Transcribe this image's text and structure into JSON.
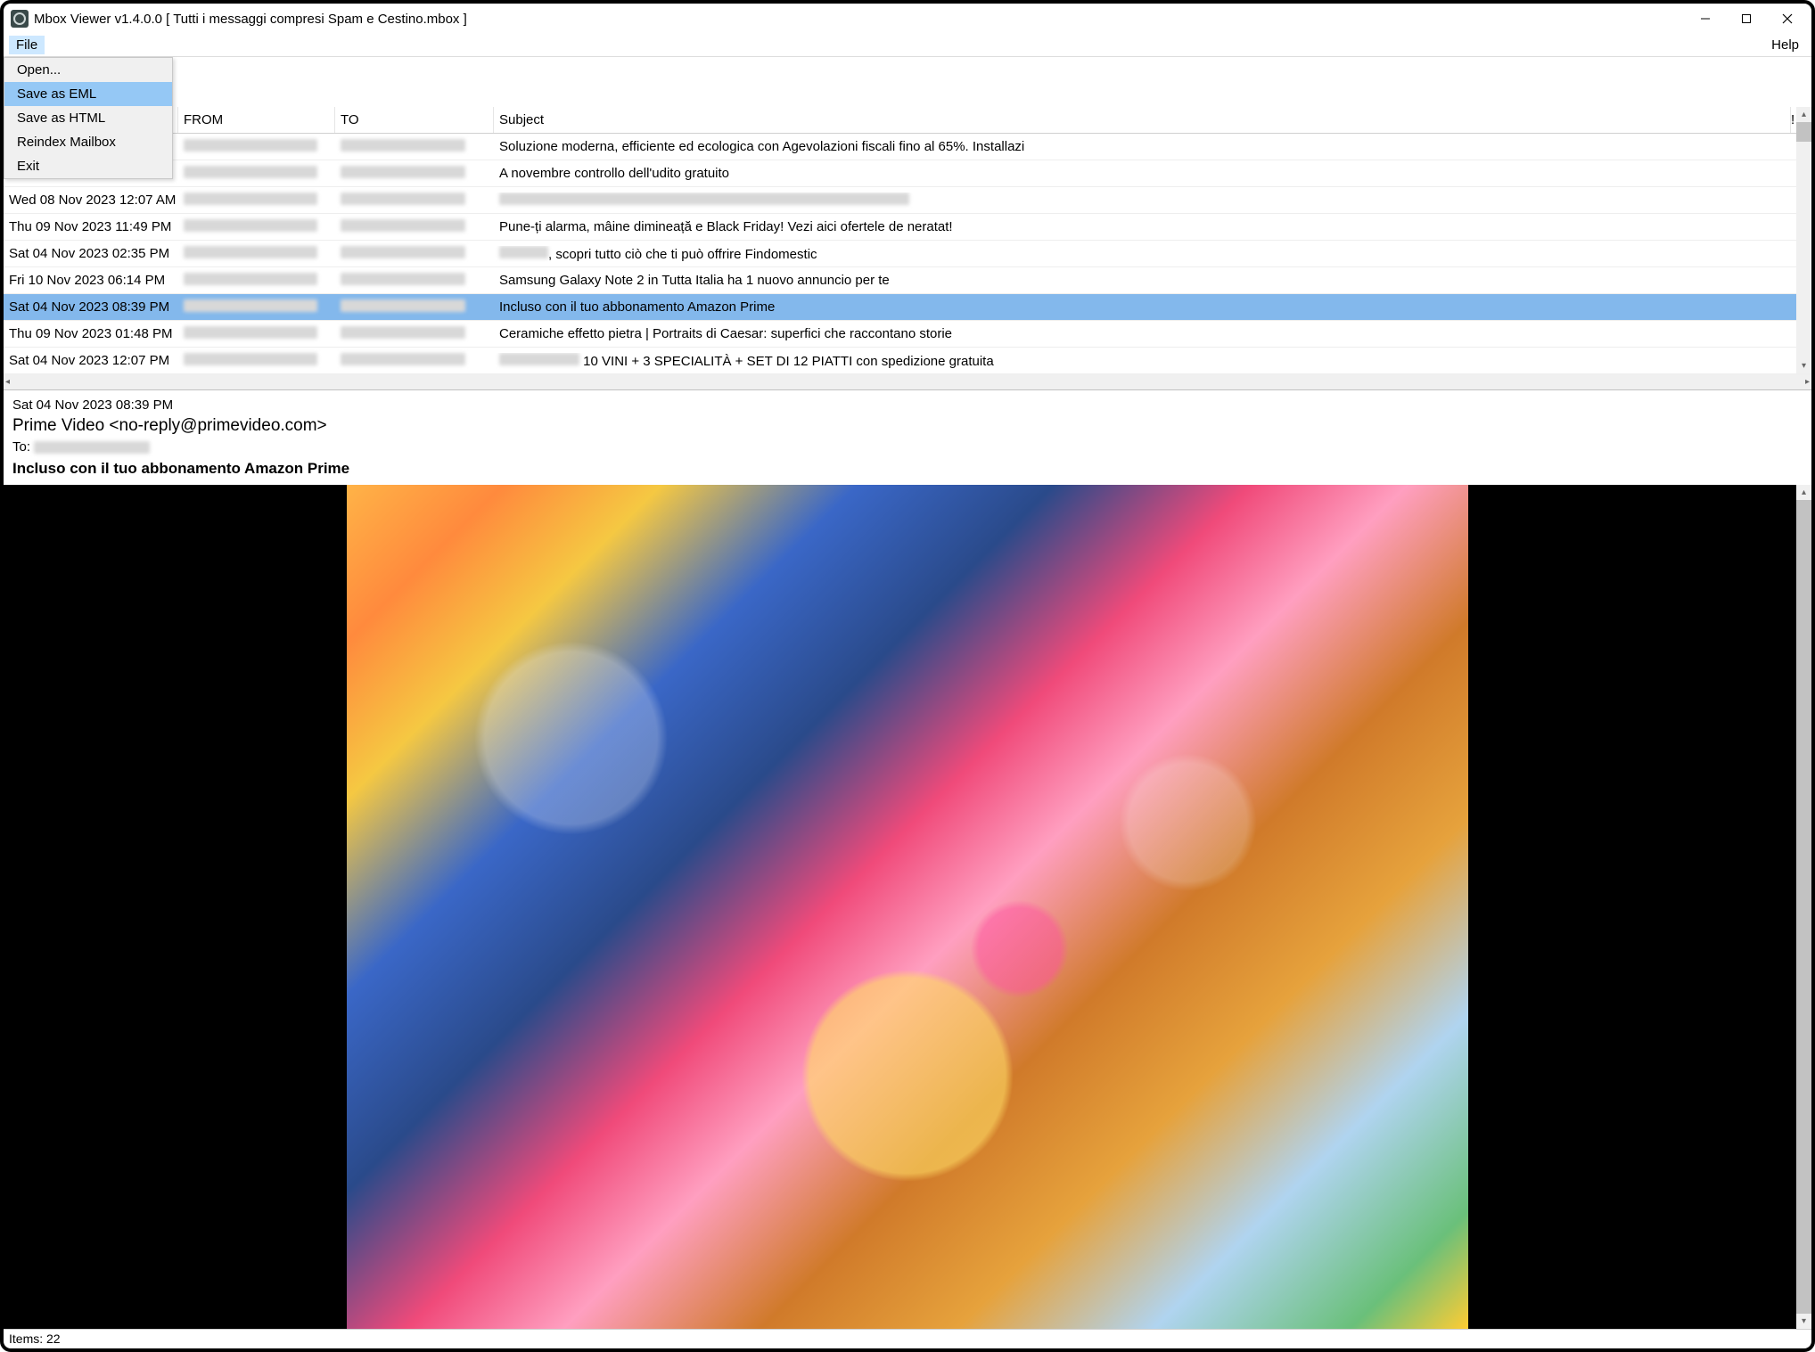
{
  "window": {
    "title": "Mbox Viewer v1.4.0.0 [ Tutti i messaggi compresi Spam e Cestino.mbox ]"
  },
  "menubar": {
    "file": "File",
    "help": "Help",
    "dropdown": {
      "open": "Open...",
      "save_eml": "Save as EML",
      "save_html": "Save as HTML",
      "reindex": "Reindex Mailbox",
      "exit": "Exit"
    }
  },
  "columns": {
    "from": "FROM",
    "to": "TO",
    "subject": "Subject",
    "flag": "!"
  },
  "rows": [
    {
      "date": "",
      "subject": "Soluzione moderna, efficiente ed ecologica con Agevolazioni fiscali fino al 65%. Installazi"
    },
    {
      "date": "",
      "subject": "A novembre controllo dell'udito gratuito"
    },
    {
      "date": "Wed 08 Nov 2023 12:07 AM",
      "subject": ""
    },
    {
      "date": "Thu 09 Nov 2023 11:49 PM",
      "subject": "Pune-ți alarma, mâine dimineață e Black Friday! Vezi aici ofertele de neratat!"
    },
    {
      "date": "Sat 04 Nov 2023 02:35 PM",
      "subject": ", scopri tutto ciò che ti può offrire Findomestic"
    },
    {
      "date": "Fri 10 Nov 2023 06:14 PM",
      "subject": "Samsung Galaxy Note 2 in Tutta Italia ha 1 nuovo annuncio per te"
    },
    {
      "date": "Sat 04 Nov 2023 08:39 PM",
      "subject": "Incluso con il tuo abbonamento Amazon Prime",
      "selected": true
    },
    {
      "date": "Thu 09 Nov 2023 01:48 PM",
      "subject": "Ceramiche effetto pietra | Portraits di Caesar: superfici che raccontano storie"
    },
    {
      "date": "Sat 04 Nov 2023 12:07 PM",
      "subject": "10 VINI + 3 SPECIALITÀ + SET DI 12 PIATTI con spedizione gratuita"
    }
  ],
  "detail": {
    "date": "Sat 04 Nov 2023 08:39 PM",
    "from": "Prime Video <no-reply@primevideo.com>",
    "to_label": "To: ",
    "subject": "Incluso con il tuo abbonamento Amazon Prime"
  },
  "status": {
    "items": "Items: 22"
  }
}
